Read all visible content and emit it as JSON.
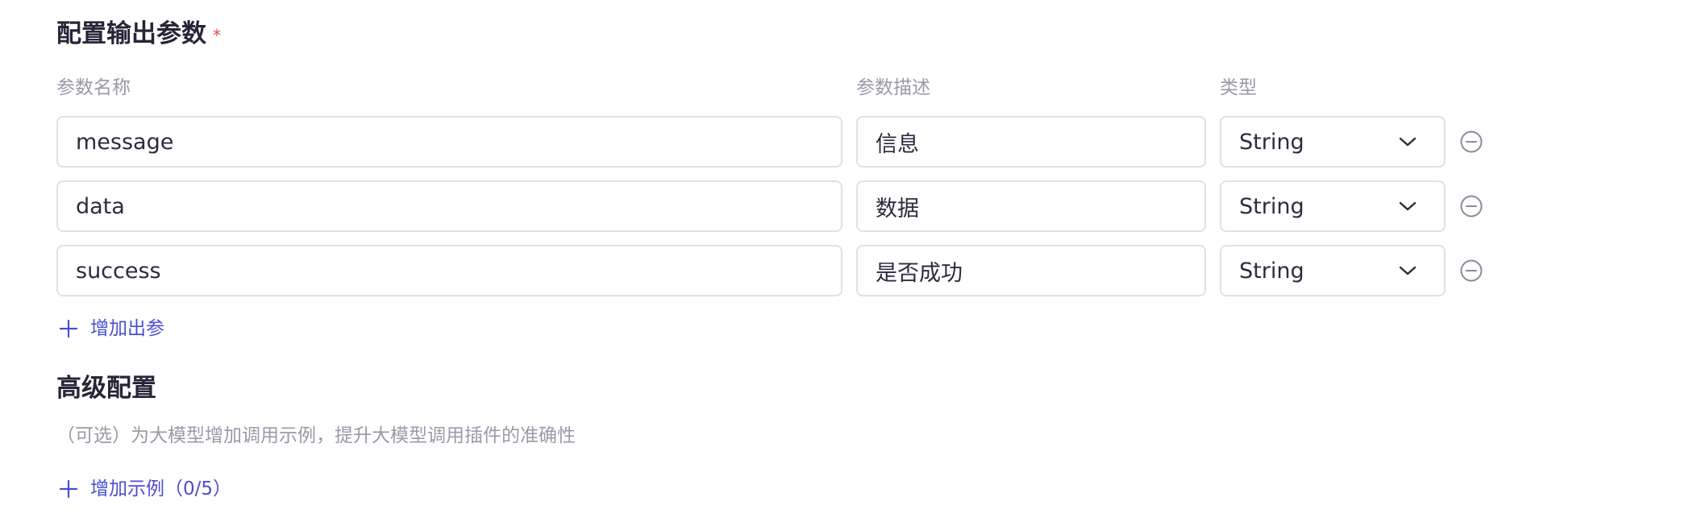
{
  "output_params": {
    "title": "配置输出参数",
    "required_mark": "*",
    "columns": {
      "name": "参数名称",
      "description": "参数描述",
      "type": "类型"
    },
    "rows": [
      {
        "name": "message",
        "description": "信息",
        "type": "String"
      },
      {
        "name": "data",
        "description": "数据",
        "type": "String"
      },
      {
        "name": "success",
        "description": "是否成功",
        "type": "String"
      }
    ],
    "add_label": "增加出参"
  },
  "advanced": {
    "title": "高级配置",
    "hint": "（可选）为大模型增加调用示例，提升大模型调用插件的准确性",
    "add_example_label": "增加示例（0/5）"
  },
  "icons": {
    "remove": "minus-circle-icon",
    "dropdown": "chevron-down-icon",
    "add": "plus-icon"
  },
  "colors": {
    "accent": "#4a4ed0",
    "required": "#e5484d",
    "muted_text": "#9a9aa8",
    "border": "#e0e0e8"
  }
}
